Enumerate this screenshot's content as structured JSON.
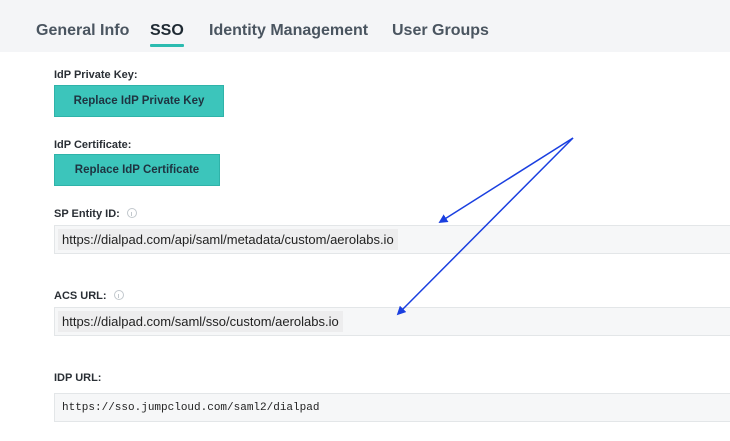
{
  "tabs": [
    {
      "label": "General Info",
      "active": false
    },
    {
      "label": "SSO",
      "active": true
    },
    {
      "label": "Identity Management",
      "active": false
    },
    {
      "label": "User Groups",
      "active": false
    }
  ],
  "sso": {
    "idp_private_key": {
      "label": "IdP Private Key:",
      "button": "Replace IdP Private Key"
    },
    "idp_certificate": {
      "label": "IdP Certificate:",
      "button": "Replace IdP Certificate"
    },
    "sp_entity_id": {
      "label": "SP Entity ID:",
      "value": "https://dialpad.com/api/saml/metadata/custom/aerolabs.io",
      "info_icon": "info-icon"
    },
    "acs_url": {
      "label": "ACS URL:",
      "value": "https://dialpad.com/saml/sso/custom/aerolabs.io",
      "info_icon": "info-icon"
    },
    "idp_url": {
      "label": "IDP URL:",
      "value": "https://sso.jumpcloud.com/saml2/dialpad"
    }
  },
  "colors": {
    "accent": "#3cc5bb",
    "tab_underline": "#2bbbb0",
    "annotation_arrow": "#1a3fe0",
    "tab_bar_bg": "#f4f5f7"
  }
}
